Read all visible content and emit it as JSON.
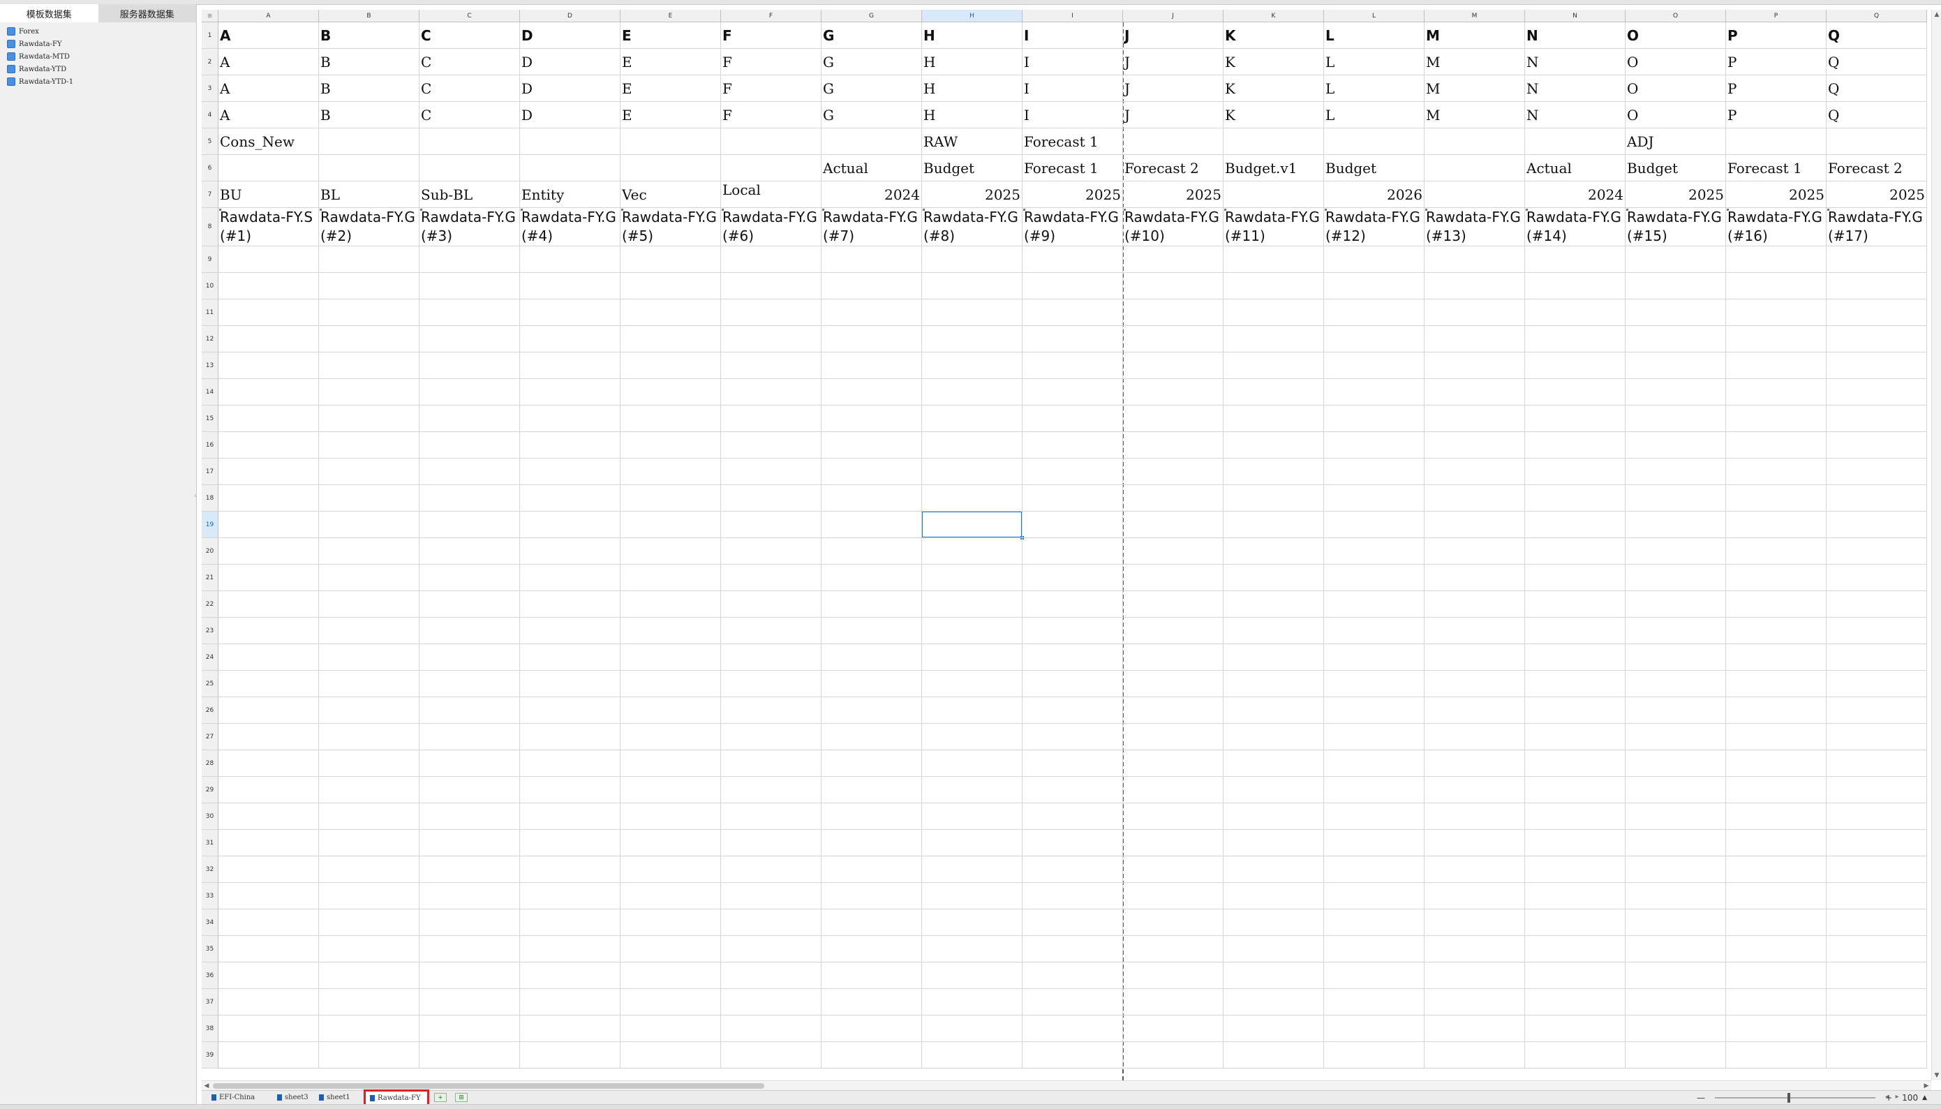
{
  "left_panel": {
    "tabs": [
      {
        "label": "模板数据集",
        "active": true
      },
      {
        "label": "服务器数据集",
        "active": false
      }
    ],
    "datasets": [
      "Forex",
      "Rawdata-FY",
      "Rawdata-MTD",
      "Rawdata-YTD",
      "Rawdata-YTD-1"
    ]
  },
  "sheet": {
    "columns": [
      "A",
      "B",
      "C",
      "D",
      "E",
      "F",
      "G",
      "H",
      "I",
      "J",
      "K",
      "L",
      "M",
      "N",
      "O",
      "P",
      "Q"
    ],
    "selected_column": "H",
    "selected_row": 19,
    "row_count": 39,
    "rows": [
      [
        "A",
        "B",
        "C",
        "D",
        "E",
        "F",
        "G",
        "H",
        "I",
        "J",
        "K",
        "L",
        "M",
        "N",
        "O",
        "P",
        "Q"
      ],
      [
        "A",
        "B",
        "C",
        "D",
        "E",
        "F",
        "G",
        "H",
        "I",
        "J",
        "K",
        "L",
        "M",
        "N",
        "O",
        "P",
        "Q"
      ],
      [
        "A",
        "B",
        "C",
        "D",
        "E",
        "F",
        "G",
        "H",
        "I",
        "J",
        "K",
        "L",
        "M",
        "N",
        "O",
        "P",
        "Q"
      ],
      [
        "A",
        "B",
        "C",
        "D",
        "E",
        "F",
        "G",
        "H",
        "I",
        "J",
        "K",
        "L",
        "M",
        "N",
        "O",
        "P",
        "Q"
      ],
      [
        "Cons_New",
        "",
        "",
        "",
        "",
        "",
        "",
        "RAW",
        "Forecast 1",
        "",
        "",
        "",
        "",
        "",
        "ADJ",
        "",
        ""
      ],
      [
        "",
        "",
        "",
        "",
        "",
        "",
        "Actual",
        "Budget",
        "Forecast 1",
        "Forecast 2",
        "Budget.v1",
        "Budget",
        "",
        "Actual",
        "Budget",
        "Forecast 1",
        "Forecast 2"
      ],
      [
        "BU",
        "BL",
        "Sub-BL",
        "Entity",
        "Vec",
        "Local",
        "2024",
        "2025",
        "2025",
        "2025",
        "",
        "2026",
        "",
        "2024",
        "2025",
        "2025",
        "2025"
      ],
      [
        "Rawdata-FY.S(#1)",
        "Rawdata-FY.G(#2)",
        "Rawdata-FY.G(#3)",
        "Rawdata-FY.G(#4)",
        "Rawdata-FY.G(#5)",
        "Rawdata-FY.G(#6)",
        "Rawdata-FY.G(#7)",
        "Rawdata-FY.G(#8)",
        "Rawdata-FY.G(#9)",
        "Rawdata-FY.G(#10)",
        "Rawdata-FY.G(#11)",
        "Rawdata-FY.G(#12)",
        "Rawdata-FY.G(#13)",
        "Rawdata-FY.G(#14)",
        "Rawdata-FY.G(#15)",
        "Rawdata-FY.G(#16)",
        "Rawdata-FY.G(#17)"
      ]
    ]
  },
  "sheet_tabs": [
    {
      "label": "EFI-China",
      "active": false
    },
    {
      "label": "sheet3",
      "active": false
    },
    {
      "label": "sheet1",
      "active": false
    },
    {
      "label": "Rawdata-FY",
      "active": true
    }
  ],
  "zoom": {
    "minus": "—",
    "plus": "+",
    "value": "100"
  },
  "colors": {
    "selection": "#1a73e8",
    "active_tab_border": "#e02020",
    "dataset_icon": "#4a90e2"
  }
}
